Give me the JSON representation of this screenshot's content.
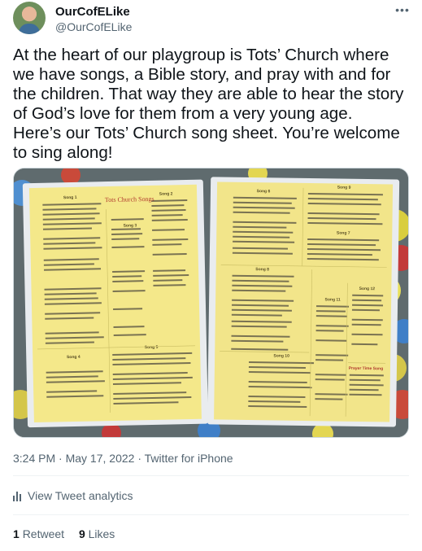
{
  "user": {
    "display_name": "OurCofELike",
    "handle": "@OurCofELike"
  },
  "menu": {
    "more_icon": "ellipsis-icon"
  },
  "tweet": {
    "text": "At the heart of our playgroup is Tots’ Church where we have songs, a Bible story, and pray with and for the children. That way they are able to hear the story of God’s love for them from a very young age.\nHere’s our Tots’ Church song sheet. You’re welcome to sing along!"
  },
  "photo": {
    "sheet_left": {
      "title": "Tots Church Songs",
      "songs": [
        "Song 1",
        "Song 2",
        "Song 3",
        "Song 4",
        "Song 5"
      ]
    },
    "sheet_right": {
      "songs": [
        "Song 6",
        "Song 7",
        "Song 8",
        "Song 9",
        "Song 10",
        "Song 11",
        "Song 12"
      ],
      "prayer": "Prayer Time Song"
    }
  },
  "meta": {
    "time": "3:24 PM",
    "separator": " · ",
    "date": "May 17, 2022",
    "source": "Twitter for iPhone"
  },
  "analytics": {
    "label": "View Tweet analytics",
    "icon": "bar-chart-icon"
  },
  "stats": {
    "retweets_count": "1",
    "retweets_label": "Retweet",
    "likes_count": "9",
    "likes_label": "Likes"
  },
  "colors": {
    "text": "#0f1419",
    "secondary": "#536471",
    "sheet_yellow": "#f4e88a",
    "sheet_title": "#c0392b"
  }
}
